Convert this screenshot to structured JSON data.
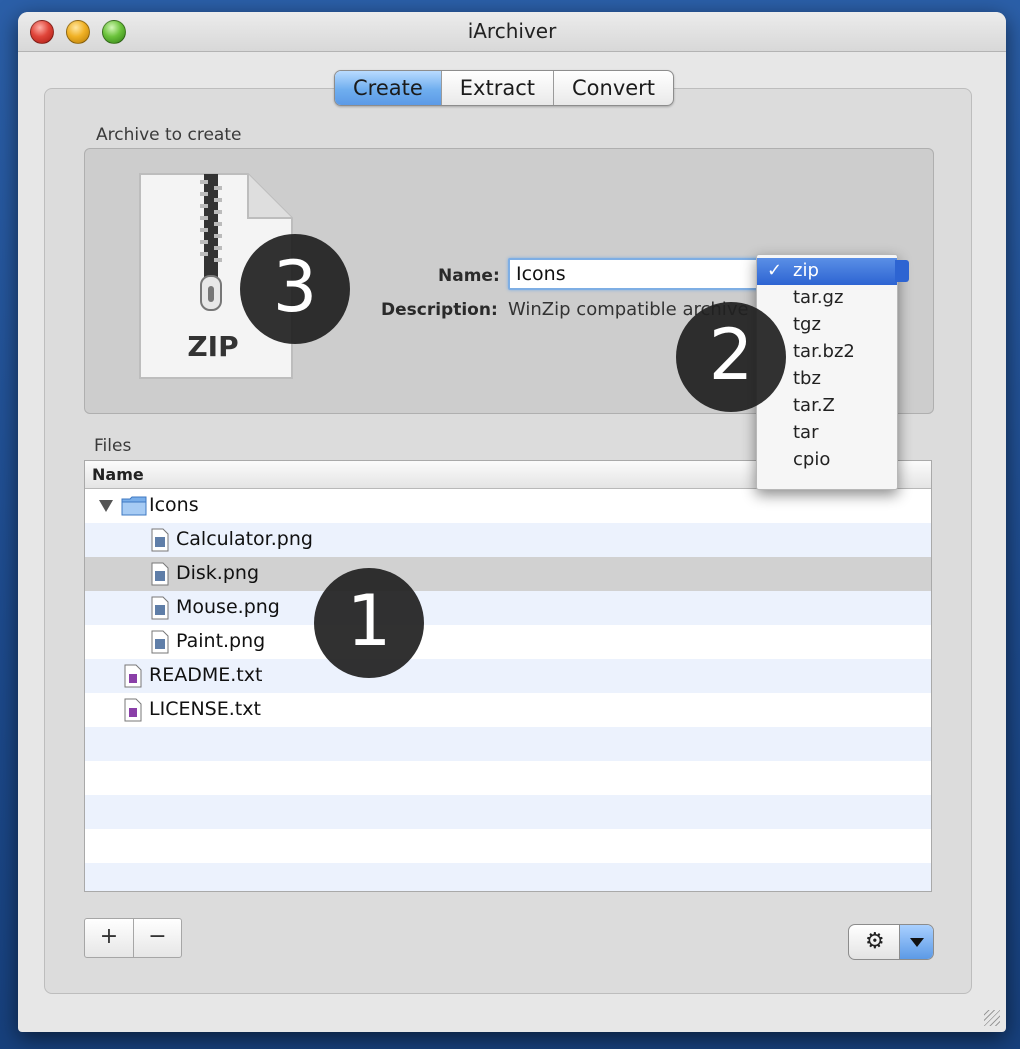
{
  "window": {
    "title": "iArchiver"
  },
  "tabs": [
    {
      "label": "Create",
      "active": true
    },
    {
      "label": "Extract",
      "active": false
    },
    {
      "label": "Convert",
      "active": false
    }
  ],
  "archive": {
    "section_label": "Archive to create",
    "icon_label": "ZIP",
    "name_label": "Name:",
    "name_value": "Icons",
    "description_label": "Description:",
    "description_value": "WinZip compatible archive",
    "format_options": [
      "zip",
      "tar.gz",
      "tgz",
      "tar.bz2",
      "tbz",
      "tar.Z",
      "tar",
      "cpio"
    ],
    "selected_format": "zip",
    "check_mark": "✓"
  },
  "files": {
    "section_label": "Files",
    "column_header": "Name",
    "rows": [
      {
        "name": "Icons",
        "type": "folder",
        "level": 0
      },
      {
        "name": "Calculator.png",
        "type": "image",
        "level": 1
      },
      {
        "name": "Disk.png",
        "type": "image",
        "level": 1,
        "selected": true
      },
      {
        "name": "Mouse.png",
        "type": "image",
        "level": 1
      },
      {
        "name": "Paint.png",
        "type": "image",
        "level": 1
      },
      {
        "name": "README.txt",
        "type": "text",
        "level": 0
      },
      {
        "name": "LICENSE.txt",
        "type": "text",
        "level": 0
      }
    ]
  },
  "callouts": [
    "1",
    "2",
    "3"
  ],
  "buttons": {
    "add_label": "+",
    "remove_label": "−",
    "action_icon": "gear-icon"
  },
  "colors": {
    "accent": "#2d64d2",
    "selected_row": "#d1d1d1",
    "alt_row": "#ecf2fd"
  }
}
